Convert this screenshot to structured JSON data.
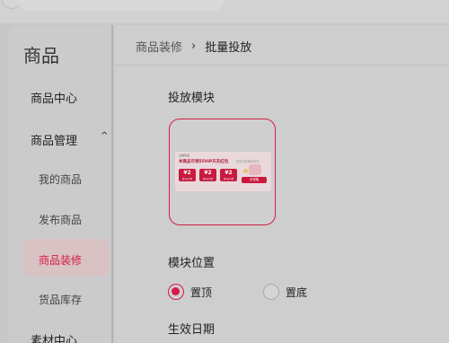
{
  "sidebar": {
    "brand": "商品",
    "items": [
      {
        "label": "商品中心"
      },
      {
        "label": "商品管理"
      },
      {
        "label": "我的商品"
      },
      {
        "label": "发布商品"
      },
      {
        "label": "商品装修"
      },
      {
        "label": "货品库存"
      }
    ],
    "partial_item": "素材中心"
  },
  "breadcrumb": {
    "parent": "商品装修",
    "separator": "›",
    "current": "批量投放"
  },
  "sections": {
    "module": "投放模块",
    "position": "模块位置",
    "effective_date": "生效日期"
  },
  "module_preview": {
    "header": "主推商品",
    "title": "本商品可领55VIP天天红包",
    "hint": "更多优惠等你来领",
    "coupons": [
      {
        "value": "¥2",
        "sub": "满1元可用"
      },
      {
        "value": "¥2",
        "sub": "满1元可用"
      },
      {
        "value": "¥2",
        "sub": "满1元可用"
      }
    ],
    "cta": "去领取"
  },
  "position_options": [
    {
      "label": "置顶",
      "selected": true
    },
    {
      "label": "置底",
      "selected": false
    }
  ],
  "colors": {
    "accent": "#d41c45",
    "active_bg": "#d9c2c4"
  }
}
